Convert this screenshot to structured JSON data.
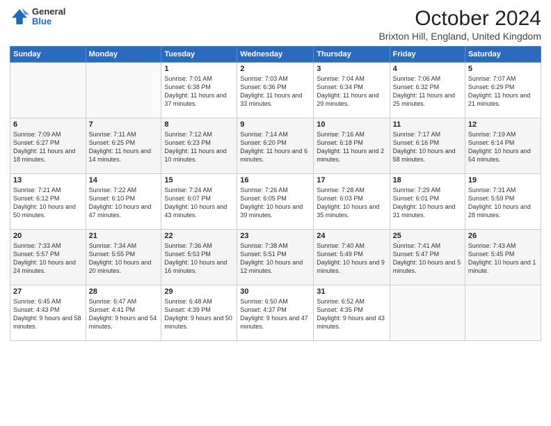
{
  "logo": {
    "general": "General",
    "blue": "Blue"
  },
  "title": "October 2024",
  "subtitle": "Brixton Hill, England, United Kingdom",
  "days_of_week": [
    "Sunday",
    "Monday",
    "Tuesday",
    "Wednesday",
    "Thursday",
    "Friday",
    "Saturday"
  ],
  "weeks": [
    [
      {
        "day": "",
        "info": ""
      },
      {
        "day": "",
        "info": ""
      },
      {
        "day": "1",
        "info": "Sunrise: 7:01 AM\nSunset: 6:38 PM\nDaylight: 11 hours and 37 minutes."
      },
      {
        "day": "2",
        "info": "Sunrise: 7:03 AM\nSunset: 6:36 PM\nDaylight: 11 hours and 33 minutes."
      },
      {
        "day": "3",
        "info": "Sunrise: 7:04 AM\nSunset: 6:34 PM\nDaylight: 11 hours and 29 minutes."
      },
      {
        "day": "4",
        "info": "Sunrise: 7:06 AM\nSunset: 6:32 PM\nDaylight: 11 hours and 25 minutes."
      },
      {
        "day": "5",
        "info": "Sunrise: 7:07 AM\nSunset: 6:29 PM\nDaylight: 11 hours and 21 minutes."
      }
    ],
    [
      {
        "day": "6",
        "info": "Sunrise: 7:09 AM\nSunset: 6:27 PM\nDaylight: 11 hours and 18 minutes."
      },
      {
        "day": "7",
        "info": "Sunrise: 7:11 AM\nSunset: 6:25 PM\nDaylight: 11 hours and 14 minutes."
      },
      {
        "day": "8",
        "info": "Sunrise: 7:12 AM\nSunset: 6:23 PM\nDaylight: 11 hours and 10 minutes."
      },
      {
        "day": "9",
        "info": "Sunrise: 7:14 AM\nSunset: 6:20 PM\nDaylight: 11 hours and 6 minutes."
      },
      {
        "day": "10",
        "info": "Sunrise: 7:16 AM\nSunset: 6:18 PM\nDaylight: 11 hours and 2 minutes."
      },
      {
        "day": "11",
        "info": "Sunrise: 7:17 AM\nSunset: 6:16 PM\nDaylight: 10 hours and 58 minutes."
      },
      {
        "day": "12",
        "info": "Sunrise: 7:19 AM\nSunset: 6:14 PM\nDaylight: 10 hours and 54 minutes."
      }
    ],
    [
      {
        "day": "13",
        "info": "Sunrise: 7:21 AM\nSunset: 6:12 PM\nDaylight: 10 hours and 50 minutes."
      },
      {
        "day": "14",
        "info": "Sunrise: 7:22 AM\nSunset: 6:10 PM\nDaylight: 10 hours and 47 minutes."
      },
      {
        "day": "15",
        "info": "Sunrise: 7:24 AM\nSunset: 6:07 PM\nDaylight: 10 hours and 43 minutes."
      },
      {
        "day": "16",
        "info": "Sunrise: 7:26 AM\nSunset: 6:05 PM\nDaylight: 10 hours and 39 minutes."
      },
      {
        "day": "17",
        "info": "Sunrise: 7:28 AM\nSunset: 6:03 PM\nDaylight: 10 hours and 35 minutes."
      },
      {
        "day": "18",
        "info": "Sunrise: 7:29 AM\nSunset: 6:01 PM\nDaylight: 10 hours and 31 minutes."
      },
      {
        "day": "19",
        "info": "Sunrise: 7:31 AM\nSunset: 5:59 PM\nDaylight: 10 hours and 28 minutes."
      }
    ],
    [
      {
        "day": "20",
        "info": "Sunrise: 7:33 AM\nSunset: 5:57 PM\nDaylight: 10 hours and 24 minutes."
      },
      {
        "day": "21",
        "info": "Sunrise: 7:34 AM\nSunset: 5:55 PM\nDaylight: 10 hours and 20 minutes."
      },
      {
        "day": "22",
        "info": "Sunrise: 7:36 AM\nSunset: 5:53 PM\nDaylight: 10 hours and 16 minutes."
      },
      {
        "day": "23",
        "info": "Sunrise: 7:38 AM\nSunset: 5:51 PM\nDaylight: 10 hours and 12 minutes."
      },
      {
        "day": "24",
        "info": "Sunrise: 7:40 AM\nSunset: 5:49 PM\nDaylight: 10 hours and 9 minutes."
      },
      {
        "day": "25",
        "info": "Sunrise: 7:41 AM\nSunset: 5:47 PM\nDaylight: 10 hours and 5 minutes."
      },
      {
        "day": "26",
        "info": "Sunrise: 7:43 AM\nSunset: 5:45 PM\nDaylight: 10 hours and 1 minute."
      }
    ],
    [
      {
        "day": "27",
        "info": "Sunrise: 6:45 AM\nSunset: 4:43 PM\nDaylight: 9 hours and 58 minutes."
      },
      {
        "day": "28",
        "info": "Sunrise: 6:47 AM\nSunset: 4:41 PM\nDaylight: 9 hours and 54 minutes."
      },
      {
        "day": "29",
        "info": "Sunrise: 6:48 AM\nSunset: 4:39 PM\nDaylight: 9 hours and 50 minutes."
      },
      {
        "day": "30",
        "info": "Sunrise: 6:50 AM\nSunset: 4:37 PM\nDaylight: 9 hours and 47 minutes."
      },
      {
        "day": "31",
        "info": "Sunrise: 6:52 AM\nSunset: 4:35 PM\nDaylight: 9 hours and 43 minutes."
      },
      {
        "day": "",
        "info": ""
      },
      {
        "day": "",
        "info": ""
      }
    ]
  ]
}
